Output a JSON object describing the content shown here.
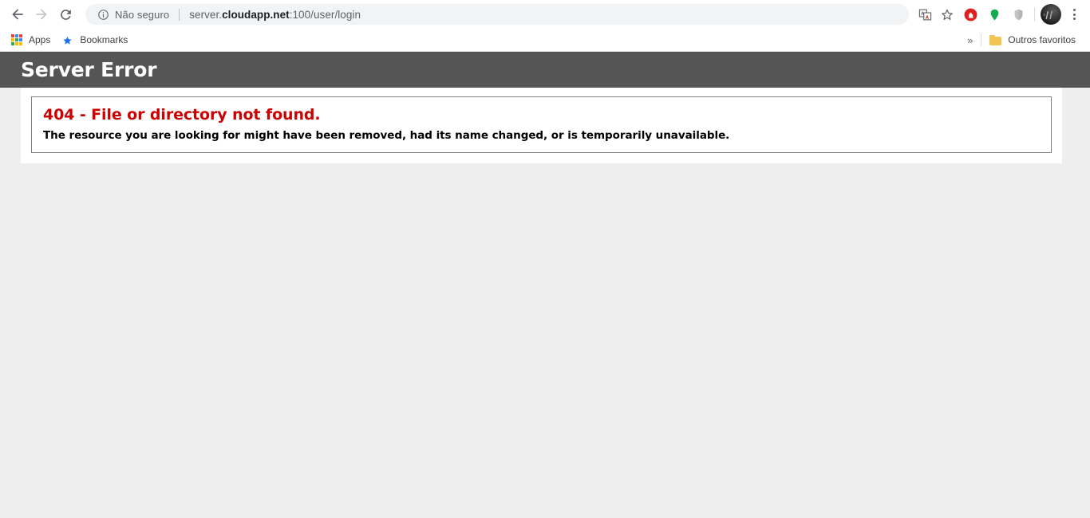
{
  "browser": {
    "nav": {
      "back_label": "Back",
      "back_icon": "arrow-left-icon",
      "forward_label": "Forward",
      "forward_icon": "arrow-right-icon",
      "reload_label": "Reload",
      "reload_icon": "reload-icon"
    },
    "omnibox": {
      "info_icon": "info-circle-icon",
      "security_text": "Não seguro",
      "url_prefix": "server.",
      "url_host": "cloudapp.net",
      "url_suffix": ":100/user/login",
      "url_full": "server.cloudapp.net:100/user/login"
    },
    "toolbar_icons": [
      {
        "name": "translate-icon",
        "title": "Traduzir esta página"
      },
      {
        "name": "bookmark-star-icon",
        "title": "Adicionar aos favoritos"
      },
      {
        "name": "adblock-extension-icon",
        "title": "AdBlock",
        "color": "#e02020"
      },
      {
        "name": "green-pin-extension-icon",
        "title": "Extension",
        "color": "#13aa52"
      },
      {
        "name": "shield-extension-icon",
        "title": "Extension",
        "color": "#bdbdbd"
      }
    ],
    "profile": {
      "avatar_name": "profile-avatar",
      "menu_icon": "kebab-menu-icon",
      "menu_label": "Personalizar e controlar o Google Chrome"
    },
    "bookmarks": {
      "apps_icon": "apps-grid-icon",
      "apps_label": "Apps",
      "bookmarks_icon": "bookmark-star-blue-icon",
      "bookmarks_label": "Bookmarks",
      "overflow_icon": "chevron-double-right-icon",
      "overflow_label": "»",
      "other_folder_icon": "folder-icon",
      "other_folder_label": "Outros favoritos"
    }
  },
  "page": {
    "header_title": "Server Error",
    "error": {
      "code_title": "404 - File or directory not found.",
      "description": "The resource you are looking for might have been removed, had its name changed, or is temporarily unavailable."
    }
  },
  "colors": {
    "header_bar": "#555555",
    "page_background": "#eeeeee",
    "error_red": "#cc0000",
    "box_border": "#808080"
  }
}
